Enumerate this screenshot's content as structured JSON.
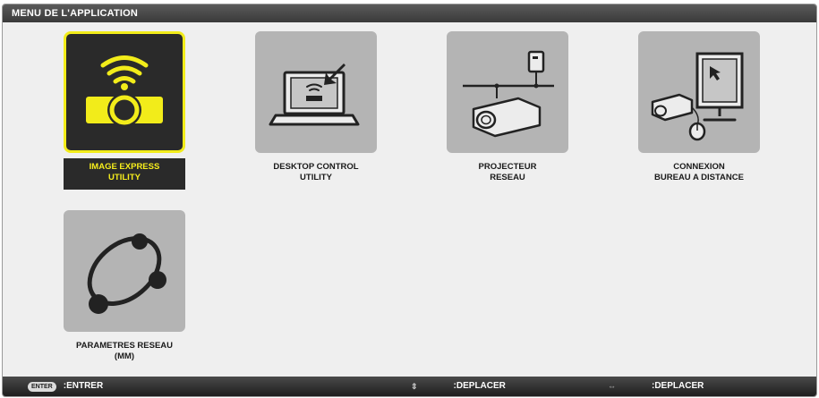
{
  "window": {
    "title": "MENU DE L'APPLICATION"
  },
  "tiles": [
    {
      "label": "IMAGE EXPRESS\nUTILITY",
      "icon": "wireless-projector-icon",
      "selected": true
    },
    {
      "label": "DESKTOP CONTROL\nUTILITY",
      "icon": "laptop-control-icon",
      "selected": false
    },
    {
      "label": "PROJECTEUR\nRESEAU",
      "icon": "network-projector-icon",
      "selected": false
    },
    {
      "label": "CONNEXION\nBUREAU A DISTANCE",
      "icon": "remote-desktop-icon",
      "selected": false
    },
    {
      "label": "PARAMETRES RESEAU\n(MM)",
      "icon": "network-settings-icon",
      "selected": false
    }
  ],
  "footer": {
    "enter_key": "ENTER",
    "enter_label": ":ENTRER",
    "updown_symbol": "⇕",
    "updown_label": ":DEPLACER",
    "leftright_symbol": "⇔",
    "leftright_label": ":DEPLACER"
  },
  "colors": {
    "highlight": "#f2ec1a",
    "tile_bg": "#b4b4b4",
    "selected_bg": "#2a2a2a"
  }
}
